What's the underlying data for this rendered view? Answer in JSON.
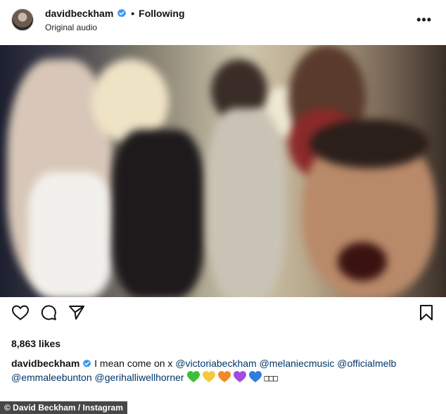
{
  "header": {
    "username": "davidbeckham",
    "separator": "•",
    "follow_status": "Following",
    "audio_label": "Original audio",
    "more_icon": "more-horizontal-icon"
  },
  "post": {
    "likes": "8,863 likes",
    "caption": {
      "username": "davidbeckham",
      "text": "I mean come on x",
      "tags": [
        "@victoriabeckham",
        "@melaniecmusic",
        "@officialmelb",
        "@emmaleebunton",
        "@gerihalliwellhorner"
      ],
      "emoji_hearts": [
        "#3cbf3a",
        "#f6c83b",
        "#f08a24",
        "#a24be0",
        "#2f7de1"
      ],
      "trailing_glyphs": "□□□"
    }
  },
  "icons": {
    "like": "heart-icon",
    "comment": "comment-icon",
    "share": "send-icon",
    "save": "bookmark-icon"
  },
  "colors": {
    "verified_badge": "#3897f0",
    "tag_link": "#00376b"
  },
  "credit": "© David Beckham / Instagram"
}
